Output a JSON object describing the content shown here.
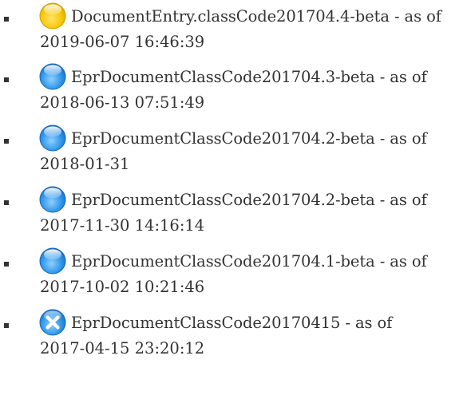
{
  "colors": {
    "text": "#333333",
    "status_current": "#f5c400",
    "status_previous": "#2a93e6",
    "status_removed": "#3f9fe8"
  },
  "versions": [
    {
      "status_icon": "yellow-circle-icon",
      "name": "DocumentEntry.classCode201704.4-beta",
      "separator": " - as of",
      "date": "2019-06-07 16:46:39"
    },
    {
      "status_icon": "blue-circle-icon",
      "name": "EprDocumentClassCode201704.3-beta",
      "separator": " - as of",
      "date": "2018-06-13 07:51:49"
    },
    {
      "status_icon": "blue-circle-icon",
      "name": "EprDocumentClassCode201704.2-beta",
      "separator": " - as of",
      "date": "2018-01-31"
    },
    {
      "status_icon": "blue-circle-icon",
      "name": "EprDocumentClassCode201704.2-beta",
      "separator": " - as of",
      "date": "2017-11-30 14:16:14"
    },
    {
      "status_icon": "blue-circle-icon",
      "name": "EprDocumentClassCode201704.1-beta",
      "separator": " - as of",
      "date": "2017-10-02 10:21:46"
    },
    {
      "status_icon": "blue-x-circle-icon",
      "name": "EprDocumentClassCode20170415",
      "separator": " - as of",
      "date": "2017-04-15 23:20:12"
    }
  ]
}
